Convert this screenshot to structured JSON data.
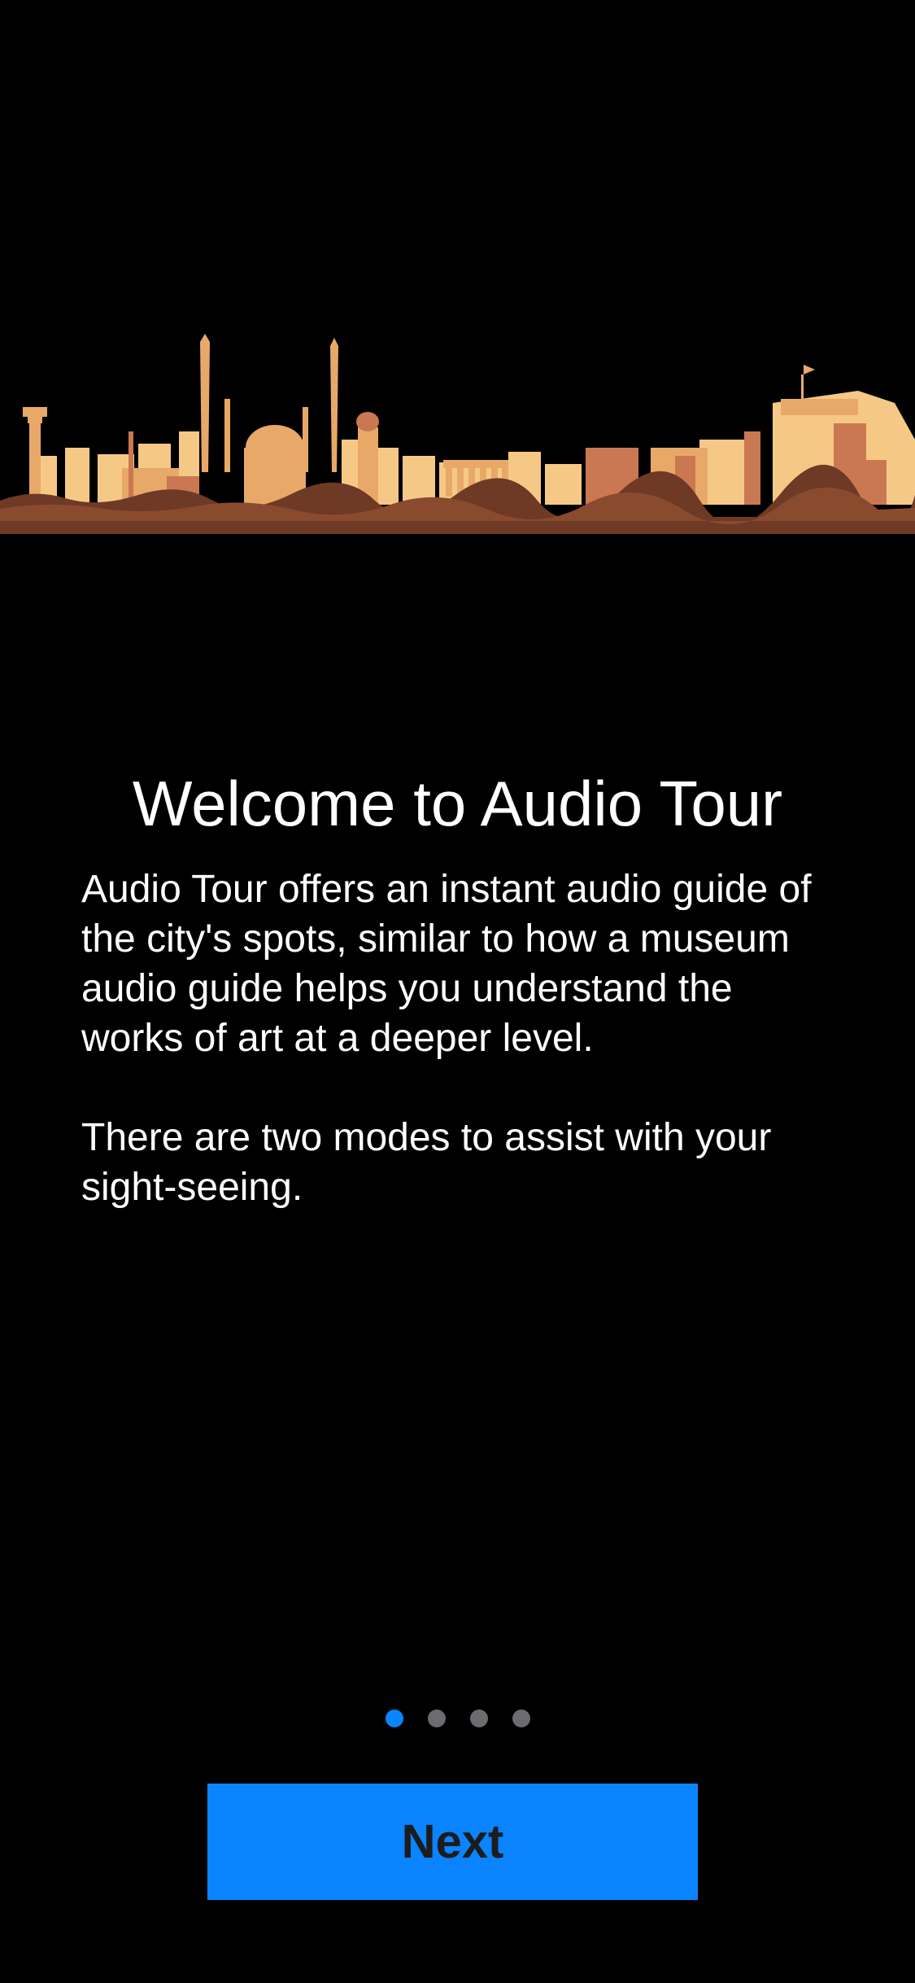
{
  "illustration": {
    "icon": "city-skyline-illustration",
    "colors": {
      "light": "#f5c985",
      "mid": "#e8a968",
      "dark": "#c97852",
      "deep": "#6e3a26"
    }
  },
  "onboarding": {
    "title": "Welcome to Audio Tour",
    "paragraph_1": "Audio Tour offers an instant audio guide of the city's spots, similar to how a museum audio guide helps you understand the works of art at a deeper level.",
    "paragraph_2": "There are two modes to assist with your sight-seeing."
  },
  "pagination": {
    "total_pages": 4,
    "current_page": 1,
    "active_color": "#0a84ff",
    "inactive_color": "#6b6b70"
  },
  "actions": {
    "next_label": "Next",
    "button_color": "#0a84ff"
  }
}
